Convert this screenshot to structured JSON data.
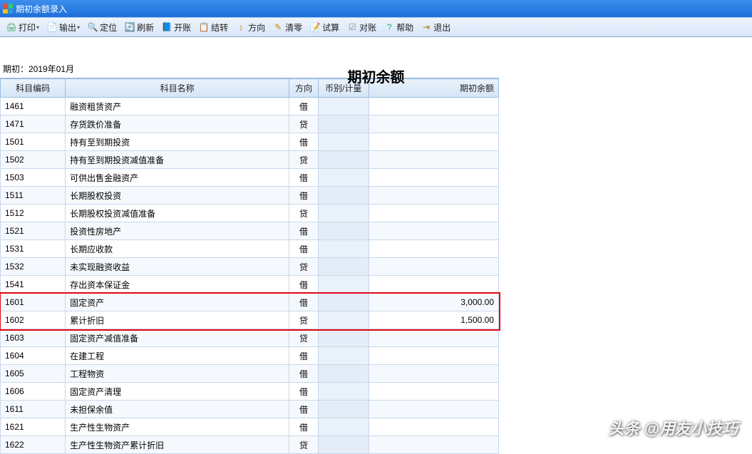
{
  "window": {
    "title": "期初余额录入"
  },
  "toolbar": [
    {
      "label": "打印",
      "icon": "printer-icon",
      "dd": true,
      "glyph": "🖨",
      "color": "#4a6"
    },
    {
      "label": "输出",
      "icon": "export-icon",
      "dd": true,
      "glyph": "📄",
      "color": "#4a6"
    },
    {
      "label": "定位",
      "icon": "locate-icon",
      "dd": false,
      "glyph": "🔍",
      "color": "#36c"
    },
    {
      "label": "刷新",
      "icon": "refresh-icon",
      "dd": false,
      "glyph": "🔄",
      "color": "#3a5"
    },
    {
      "label": "开账",
      "icon": "open-book-icon",
      "dd": false,
      "glyph": "📘",
      "color": "#777"
    },
    {
      "label": "结转",
      "icon": "carry-icon",
      "dd": false,
      "glyph": "📋",
      "color": "#777"
    },
    {
      "label": "方向",
      "icon": "direction-icon",
      "dd": false,
      "glyph": "↕",
      "color": "#c80"
    },
    {
      "label": "清零",
      "icon": "clear-icon",
      "dd": false,
      "glyph": "✎",
      "color": "#c80"
    },
    {
      "label": "试算",
      "icon": "calc-icon",
      "dd": false,
      "glyph": "📝",
      "color": "#888"
    },
    {
      "label": "对账",
      "icon": "reconcile-icon",
      "dd": false,
      "glyph": "☑",
      "color": "#888"
    },
    {
      "label": "帮助",
      "icon": "help-icon",
      "dd": false,
      "glyph": "?",
      "color": "#2a8"
    },
    {
      "label": "退出",
      "icon": "exit-icon",
      "dd": false,
      "glyph": "⇥",
      "color": "#c70"
    }
  ],
  "page": {
    "title": "期初余额",
    "period_label": "期初：2019年01月"
  },
  "columns": {
    "code": "科目编码",
    "name": "科目名称",
    "dir": "方向",
    "cur": "币别/计量",
    "bal": "期初余额"
  },
  "rows": [
    {
      "code": "1461",
      "name": "融资租赁资产",
      "dir": "借",
      "bal": ""
    },
    {
      "code": "1471",
      "name": "存货跌价准备",
      "dir": "贷",
      "bal": ""
    },
    {
      "code": "1501",
      "name": "持有至到期投资",
      "dir": "借",
      "bal": ""
    },
    {
      "code": "1502",
      "name": "持有至到期投资减值准备",
      "dir": "贷",
      "bal": ""
    },
    {
      "code": "1503",
      "name": "可供出售金融资产",
      "dir": "借",
      "bal": ""
    },
    {
      "code": "1511",
      "name": "长期股权投资",
      "dir": "借",
      "bal": ""
    },
    {
      "code": "1512",
      "name": "长期股权投资减值准备",
      "dir": "贷",
      "bal": ""
    },
    {
      "code": "1521",
      "name": "投资性房地产",
      "dir": "借",
      "bal": ""
    },
    {
      "code": "1531",
      "name": "长期应收款",
      "dir": "借",
      "bal": ""
    },
    {
      "code": "1532",
      "name": "未实现融资收益",
      "dir": "贷",
      "bal": ""
    },
    {
      "code": "1541",
      "name": "存出资本保证金",
      "dir": "借",
      "bal": ""
    },
    {
      "code": "1601",
      "name": "固定资产",
      "dir": "借",
      "bal": "3,000.00",
      "hl": true
    },
    {
      "code": "1602",
      "name": "累计折旧",
      "dir": "贷",
      "bal": "1,500.00",
      "hl": true
    },
    {
      "code": "1603",
      "name": "固定资产减值准备",
      "dir": "贷",
      "bal": ""
    },
    {
      "code": "1604",
      "name": "在建工程",
      "dir": "借",
      "bal": ""
    },
    {
      "code": "1605",
      "name": "工程物资",
      "dir": "借",
      "bal": ""
    },
    {
      "code": "1606",
      "name": "固定资产清理",
      "dir": "借",
      "bal": ""
    },
    {
      "code": "1611",
      "name": "未担保余值",
      "dir": "借",
      "bal": ""
    },
    {
      "code": "1621",
      "name": "生产性生物资产",
      "dir": "借",
      "bal": ""
    },
    {
      "code": "1622",
      "name": "生产性生物资产累计折旧",
      "dir": "贷",
      "bal": ""
    }
  ],
  "watermark": "头条 @用友小技巧"
}
